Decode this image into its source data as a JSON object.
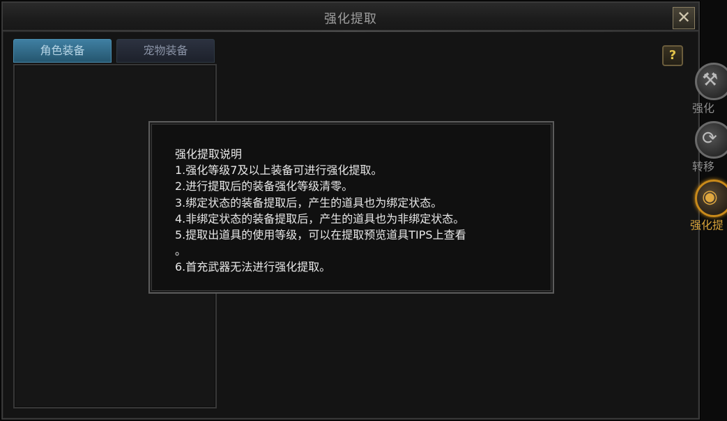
{
  "window": {
    "title": "强化提取",
    "close_label": "✕"
  },
  "tabs": [
    {
      "label": "角色装备",
      "active": true
    },
    {
      "label": "宠物装备",
      "active": false
    }
  ],
  "help": {
    "label": "?"
  },
  "side_tabs": [
    {
      "label": "强化",
      "icon": "hammer-icon",
      "glyph": "⚒",
      "active": false
    },
    {
      "label": "转移",
      "icon": "transfer-icon",
      "glyph": "⟳",
      "active": false
    },
    {
      "label": "强化提",
      "icon": "extract-icon",
      "glyph": "◉",
      "active": true
    }
  ],
  "tooltip": {
    "lines": [
      "强化提取说明",
      "1.强化等级7及以上装备可进行强化提取。",
      "2.进行提取后的装备强化等级清零。",
      "3.绑定状态的装备提取后，产生的道具也为绑定状态。",
      "4.非绑定状态的装备提取后，产生的道具也为非绑定状态。",
      "5.提取出道具的使用等级，可以在提取预览道具TIPS上查看",
      "。",
      "6.首充武器无法进行强化提取。"
    ]
  },
  "colors": {
    "accent_gold": "#c98a1a",
    "tab_active": "#3f7fa2"
  }
}
